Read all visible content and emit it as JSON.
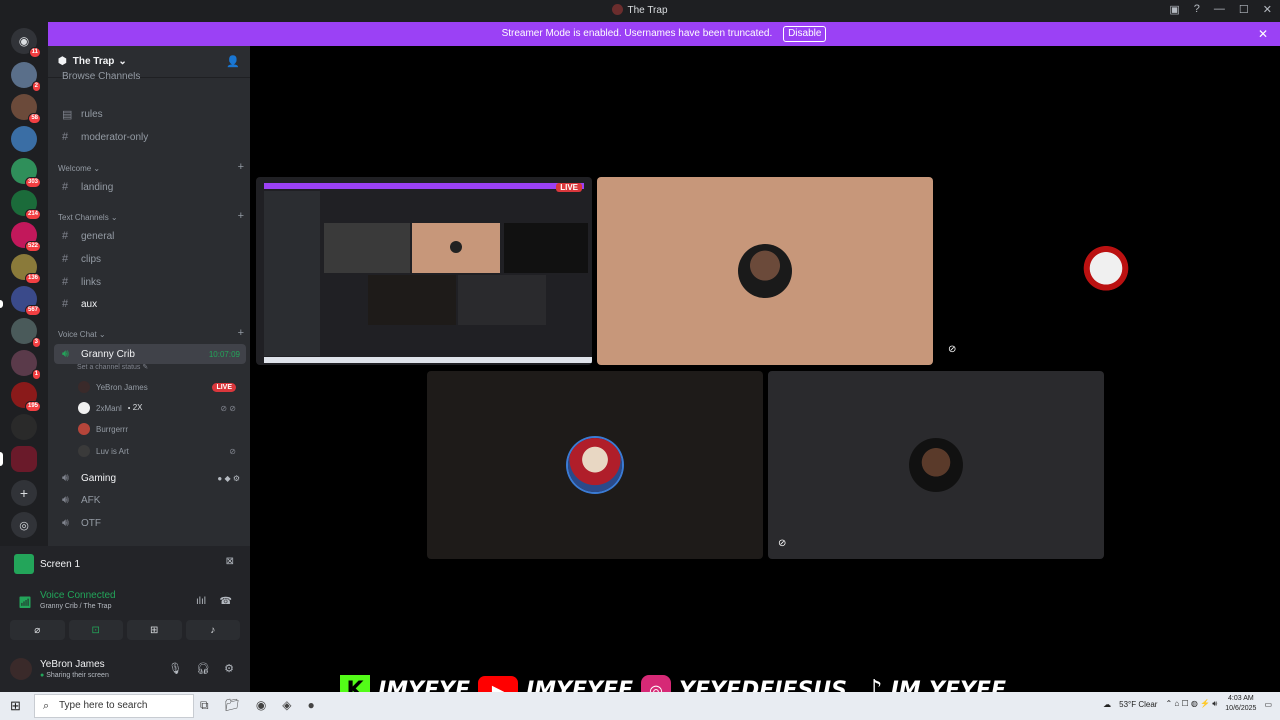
{
  "window": {
    "title": "The Trap"
  },
  "banner": {
    "text": "Streamer Mode is enabled. Usernames have been truncated.",
    "button": "Disable"
  },
  "server_rail": [
    {
      "badge": "11"
    },
    {
      "badge": "2"
    },
    {
      "badge": "58"
    },
    {
      "badge": ""
    },
    {
      "badge": "303"
    },
    {
      "badge": "214"
    },
    {
      "badge": "522"
    },
    {
      "badge": "136"
    },
    {
      "badge": "567"
    },
    {
      "badge": "3"
    },
    {
      "badge": "1"
    },
    {
      "badge": "195"
    },
    {
      "badge": ""
    },
    {
      "badge": ""
    }
  ],
  "server": {
    "name": "The Trap"
  },
  "channels": {
    "top_partial": "Browse Channels",
    "rules": "rules",
    "moderator_only": "moderator-only",
    "cat_welcome": "Welcome",
    "landing": "landing",
    "cat_text": "Text Channels",
    "general": "general",
    "clips": "clips",
    "links": "links",
    "aux": "aux",
    "cat_voice": "Voice Chat",
    "granny_crib": "Granny Crib",
    "granny_timer": "10:07:09",
    "set_status": "Set a channel status",
    "gaming": "Gaming",
    "afk": "AFK",
    "otf": "OTF"
  },
  "voice_users": [
    {
      "name": "YeBron James",
      "live": "LIVE"
    },
    {
      "name": "2xManl",
      "tag": "2X"
    },
    {
      "name": "Burrgerrr"
    },
    {
      "name": "Luv is Art"
    }
  ],
  "panel": {
    "screen": "Screen 1",
    "voice_status": "Voice Connected",
    "voice_location": "Granny Crib / The Trap",
    "username": "YeBron James",
    "user_status": "Sharing their screen"
  },
  "stage": {
    "live_badge": "LIVE"
  },
  "promo": {
    "kick": "IMYEYE",
    "youtube": "IMYEYEE",
    "instagram": "YEYEDEJESUS_",
    "tiktok": "IM.YEYEE"
  },
  "taskbar": {
    "search_placeholder": "Type here to search",
    "weather": "53°F  Clear",
    "time": "4:03 AM",
    "date": "10/6/2025"
  },
  "colors": {
    "accent": "#9b41f5",
    "online": "#23a55a",
    "live": "#da373c"
  }
}
